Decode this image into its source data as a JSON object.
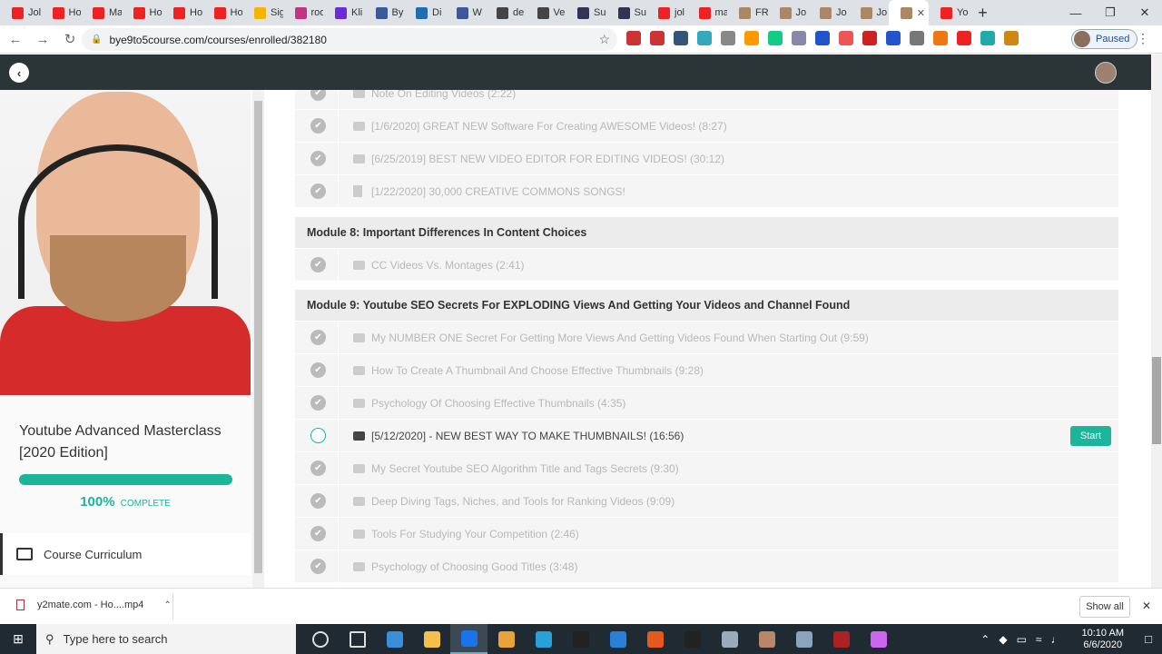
{
  "browser": {
    "tabs": [
      {
        "label": "Jol",
        "color": "#e22"
      },
      {
        "label": "Ho",
        "color": "#e22"
      },
      {
        "label": "Ma",
        "color": "#e22"
      },
      {
        "label": "Ho",
        "color": "#e22"
      },
      {
        "label": "Ho",
        "color": "#e22"
      },
      {
        "label": "Ho",
        "color": "#e22"
      },
      {
        "label": "Sig",
        "color": "#f5b400"
      },
      {
        "label": "roo",
        "color": "#c13584"
      },
      {
        "label": "Kli",
        "color": "#6b2bd9"
      },
      {
        "label": "By",
        "color": "#3b5998"
      },
      {
        "label": "Di",
        "color": "#1f6fb0"
      },
      {
        "label": "W",
        "color": "#3b5998"
      },
      {
        "label": "de",
        "color": "#444"
      },
      {
        "label": "Ve",
        "color": "#444"
      },
      {
        "label": "Su",
        "color": "#335"
      },
      {
        "label": "Su",
        "color": "#335"
      },
      {
        "label": "jol",
        "color": "#e22"
      },
      {
        "label": "ma",
        "color": "#e22"
      },
      {
        "label": "FR",
        "color": "#a86"
      },
      {
        "label": "Jo",
        "color": "#a86"
      },
      {
        "label": "Jo",
        "color": "#a86"
      },
      {
        "label": "Jo",
        "color": "#a86"
      }
    ],
    "active_tab": {
      "label": "",
      "color": "#a86"
    },
    "last_tab": {
      "label": "Yo",
      "color": "#e22"
    },
    "url": "bye9to5course.com/courses/enrolled/382180",
    "profile_status": "Paused",
    "extension_colors": [
      "#c33",
      "#c33",
      "#357",
      "#3ab",
      "#888",
      "#f90",
      "#1c8",
      "#88a",
      "#25c",
      "#e55",
      "#c22",
      "#25c",
      "#777",
      "#e71",
      "#e22",
      "#2aa",
      "#c81"
    ]
  },
  "sidebar": {
    "course_title": "Youtube Advanced Masterclass [2020 Edition]",
    "progress_percent": "100%",
    "progress_fraction": 1.0,
    "progress_label": "COMPLETE",
    "menu_item": "Course Curriculum"
  },
  "curriculum": {
    "prev_lectures": [
      {
        "title": "Note On Editing Videos (2:22)",
        "type": "video",
        "done": true
      },
      {
        "title": "[1/6/2020] GREAT NEW Software For Creating AWESOME Videos! (8:27)",
        "type": "video",
        "done": true
      },
      {
        "title": "[6/25/2019] BEST NEW VIDEO EDITOR FOR EDITING VIDEOS! (30:12)",
        "type": "video",
        "done": true
      },
      {
        "title": "[1/22/2020] 30,000 CREATIVE COMMONS SONGS!",
        "type": "doc",
        "done": true
      }
    ],
    "module8": {
      "title": "Module 8: Important Differences In Content Choices",
      "lectures": [
        {
          "title": "CC Videos Vs. Montages (2:41)",
          "type": "video",
          "done": true
        }
      ]
    },
    "module9": {
      "title": "Module 9: Youtube SEO Secrets For EXPLODING Views And Getting Your Videos and Channel Found",
      "lectures": [
        {
          "title": "My NUMBER ONE Secret For Getting More Views And Getting Videos Found When Starting Out (9:59)",
          "type": "video",
          "done": true
        },
        {
          "title": "How To Create A Thumbnail And Choose Effective Thumbnails (9:28)",
          "type": "video",
          "done": true
        },
        {
          "title": "Psychology Of Choosing Effective Thumbnails (4:35)",
          "type": "video",
          "done": true
        },
        {
          "title": "[5/12/2020] - NEW BEST WAY TO MAKE THUMBNAILS! (16:56)",
          "type": "video",
          "done": false
        },
        {
          "title": "My Secret Youtube SEO Algorithm Title and Tags Secrets (9:30)",
          "type": "video",
          "done": true
        },
        {
          "title": "Deep Diving Tags, Niches, and Tools for Ranking Videos (9:09)",
          "type": "video",
          "done": true
        },
        {
          "title": "Tools For Studying Your Competition (2:46)",
          "type": "video",
          "done": true
        },
        {
          "title": "Psychology of Choosing Good Titles (3:48)",
          "type": "video",
          "done": true
        }
      ]
    },
    "start_label": "Start"
  },
  "downloads": {
    "file": "y2mate.com - Ho....mp4",
    "show_all": "Show all"
  },
  "taskbar": {
    "search_placeholder": "Type here to search",
    "time": "10:10 AM",
    "date": "6/6/2020",
    "pinned_colors": [
      "#ddd",
      "#ddd",
      "#3b8fd9",
      "#f5c04a",
      "#1a73e8",
      "#e8a33a",
      "#29a0d8",
      "#222",
      "#2980d9",
      "#e55a1a",
      "#222",
      "#9ab",
      "#b9866a",
      "#8aa4c0",
      "#a22",
      "#c6e"
    ]
  }
}
